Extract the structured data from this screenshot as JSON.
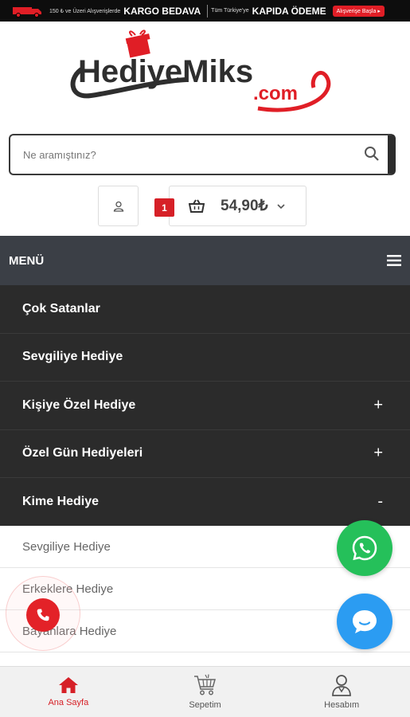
{
  "topbar": {
    "prefix": "150 ₺ ve Üzeri Alışverişlerde",
    "free_shipping": "KARGO BEDAVA",
    "middle": "Tüm Türkiye'ye",
    "cod": "KAPIDA ÖDEME",
    "cta": "Alışverişe Başla ▸"
  },
  "logo": {
    "text": "HediyeMiks",
    "suffix": ".com"
  },
  "search": {
    "placeholder": "Ne aramıştınız?"
  },
  "cart": {
    "count": "1",
    "total": "54,90₺"
  },
  "menu": {
    "title": "MENÜ",
    "items": [
      {
        "label": "Çok Satanlar",
        "control": ""
      },
      {
        "label": "Sevgiliye Hediye",
        "control": ""
      },
      {
        "label": "Kişiye Özel Hediye",
        "control": "+"
      },
      {
        "label": "Özel Gün Hediyeleri",
        "control": "+"
      },
      {
        "label": "Kime Hediye",
        "control": "-"
      }
    ],
    "subitems": [
      {
        "label": "Sevgiliye Hediye"
      },
      {
        "label": "Erkeklere Hediye"
      },
      {
        "label": "Bayanlara Hediye"
      }
    ]
  },
  "bottom_nav": [
    {
      "label": "Ana Sayfa",
      "icon": "home-icon"
    },
    {
      "label": "Sepetim",
      "icon": "cart-icon"
    },
    {
      "label": "Hesabım",
      "icon": "user-icon"
    }
  ],
  "colors": {
    "brand_red": "#d62027",
    "dark": "#2b2b2b",
    "header": "#3b3f46",
    "whatsapp": "#25c05a",
    "chat": "#2b9cf2"
  }
}
